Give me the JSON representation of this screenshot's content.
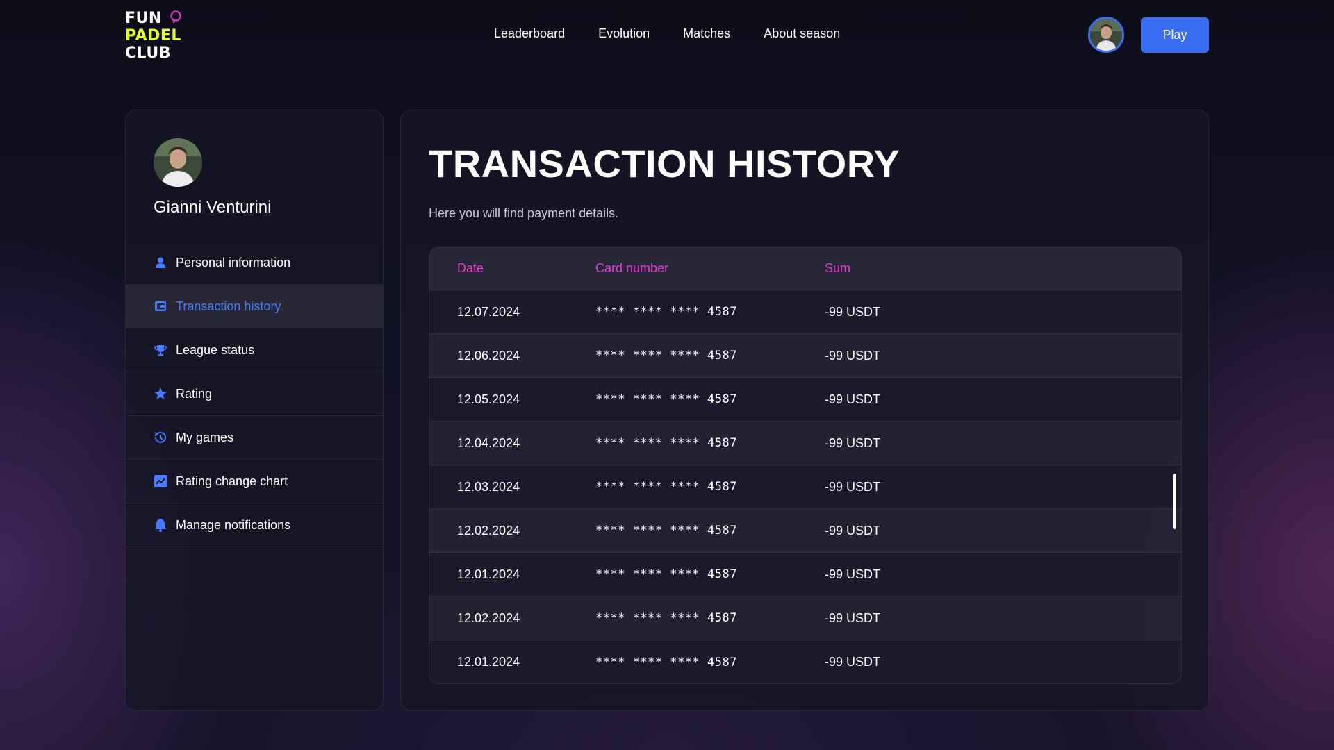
{
  "logo": {
    "line1": "FUN",
    "line2": "PADEL",
    "line3": "CLUB"
  },
  "nav": [
    "Leaderboard",
    "Evolution",
    "Matches",
    "About season"
  ],
  "header": {
    "play_label": "Play"
  },
  "profile": {
    "name": "Gianni Venturini"
  },
  "sidebar": {
    "items": [
      {
        "label": "Personal information",
        "icon": "person-icon",
        "active": false
      },
      {
        "label": "Transaction history",
        "icon": "wallet-icon",
        "active": true
      },
      {
        "label": "League status",
        "icon": "trophy-icon",
        "active": false
      },
      {
        "label": "Rating",
        "icon": "star-icon",
        "active": false
      },
      {
        "label": "My games",
        "icon": "history-icon",
        "active": false
      },
      {
        "label": "Rating change chart",
        "icon": "chart-icon",
        "active": false
      },
      {
        "label": "Manage notifications",
        "icon": "bell-icon",
        "active": false
      }
    ]
  },
  "main": {
    "title": "TRANSACTION HISTORY",
    "subtitle": "Here you will find payment details."
  },
  "table": {
    "headers": {
      "date": "Date",
      "card": "Card number",
      "sum": "Sum"
    },
    "rows": [
      {
        "date": "12.07.2024",
        "card": "**** **** **** 4587",
        "sum": "-99 USDT"
      },
      {
        "date": "12.06.2024",
        "card": "**** **** **** 4587",
        "sum": "-99 USDT"
      },
      {
        "date": "12.05.2024",
        "card": "**** **** **** 4587",
        "sum": "-99 USDT"
      },
      {
        "date": "12.04.2024",
        "card": "**** **** **** 4587",
        "sum": "-99 USDT"
      },
      {
        "date": "12.03.2024",
        "card": "**** **** **** 4587",
        "sum": "-99 USDT"
      },
      {
        "date": "12.02.2024",
        "card": "**** **** **** 4587",
        "sum": "-99 USDT"
      },
      {
        "date": "12.01.2024",
        "card": "**** **** **** 4587",
        "sum": "-99 USDT"
      },
      {
        "date": "12.02.2024",
        "card": "**** **** **** 4587",
        "sum": "-99 USDT"
      },
      {
        "date": "12.01.2024",
        "card": "**** **** **** 4587",
        "sum": "-99 USDT"
      }
    ]
  },
  "colors": {
    "accent": "#3a6ef2",
    "header_label": "#e23ed6",
    "logo_yellow": "#e6ff2b",
    "active_label": "#4a7bff"
  }
}
